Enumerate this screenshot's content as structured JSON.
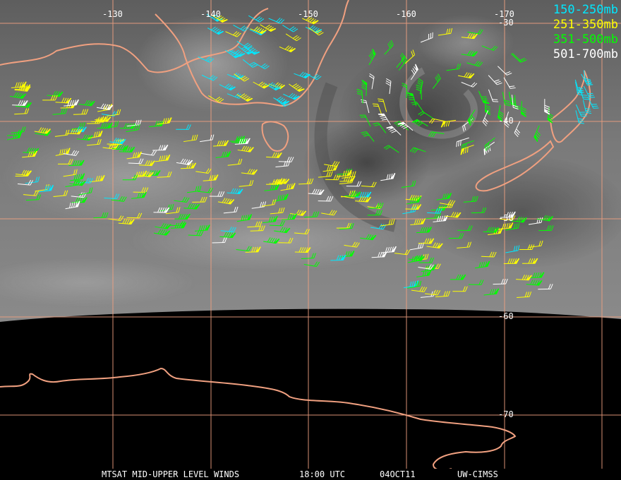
{
  "map": {
    "longitude_labels": [
      "-130",
      "-140",
      "-150",
      "-160",
      "-170"
    ],
    "latitude_labels": [
      "-30",
      "-40",
      "-50",
      "-60",
      "-70"
    ],
    "colors": {
      "sky": "#6c6c6c",
      "space": "#000000",
      "grid": "#f0a080",
      "coast": "#f0a080"
    }
  },
  "legend": {
    "items": [
      {
        "label": "150-250mb",
        "color": "#00e8ff"
      },
      {
        "label": "251-350mb",
        "color": "#ffff00"
      },
      {
        "label": "351-500mb",
        "color": "#00ff00"
      },
      {
        "label": "501-700mb",
        "color": "#ffffff"
      }
    ]
  },
  "footer": {
    "product": "MTSAT MID-UPPER LEVEL WINDS",
    "time": "18:00 UTC",
    "date": "04OCT11",
    "source": "UW-CIMSS"
  }
}
